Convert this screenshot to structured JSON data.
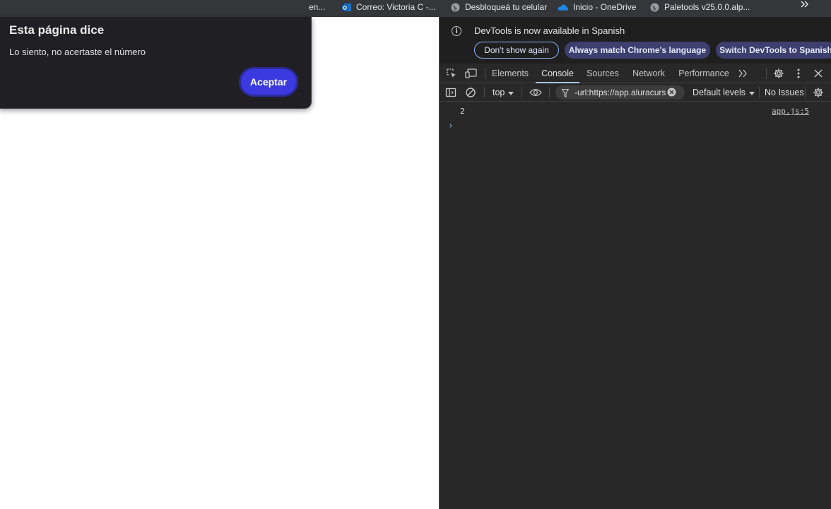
{
  "bookmarks": {
    "items": [
      {
        "label": "en..."
      },
      {
        "label": "Correo: Victoria C -..."
      },
      {
        "label": "Desbloqueá tu celular"
      },
      {
        "label": "Inicio - OneDrive"
      },
      {
        "label": "Paletools v25.0.0.alp..."
      }
    ],
    "more_icon": "chevrons-right-icon"
  },
  "dialog": {
    "title": "Esta página dice",
    "message": "Lo siento, no acertaste el número",
    "button_label": "Aceptar",
    "button_color": "#3a3ae0"
  },
  "devtools": {
    "infobar": {
      "message": "DevTools is now available in Spanish",
      "buttons": {
        "dont_show": "Don't show again",
        "always_match": "Always match Chrome's language",
        "switch": "Switch DevTools to Spanish"
      }
    },
    "tabs": {
      "elements": "Elements",
      "console": "Console",
      "sources": "Sources",
      "network": "Network",
      "performance": "Performance"
    },
    "active_tab": "Console",
    "toolbar": {
      "context": "top",
      "filter_value": "-url:https://app.aluracurs",
      "levels": "Default levels",
      "issues": "No Issues"
    },
    "console": {
      "log_value": "2",
      "log_source": "app.js:5",
      "prompt": "›"
    },
    "accent_color": "#a8c7fa"
  }
}
